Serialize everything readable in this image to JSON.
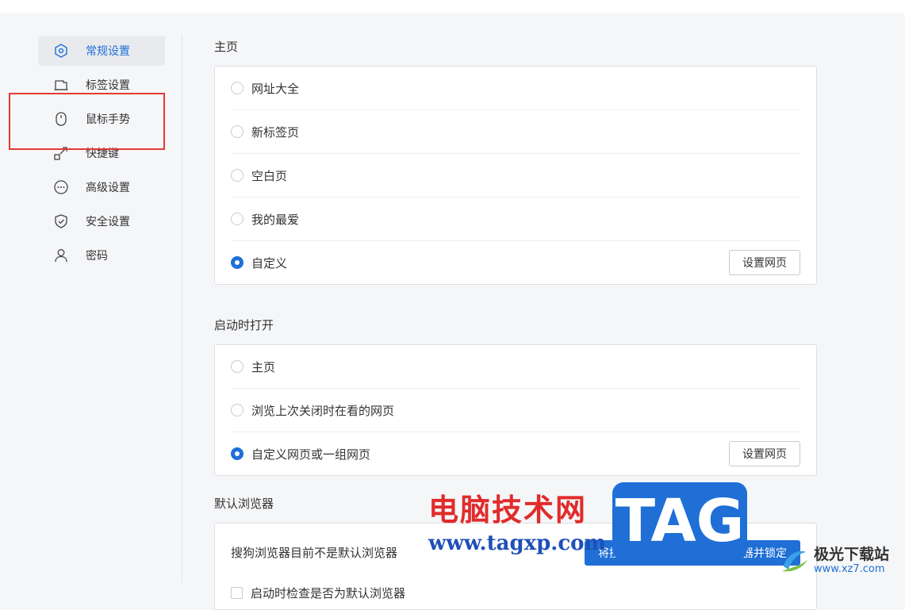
{
  "sidebar": {
    "items": [
      {
        "label": "常规设置",
        "icon": "hexagon-settings-icon",
        "active": true
      },
      {
        "label": "标签设置",
        "icon": "tab-icon"
      },
      {
        "label": "鼠标手势",
        "icon": "mouse-icon"
      },
      {
        "label": "快捷键",
        "icon": "shortcut-icon"
      },
      {
        "label": "高级设置",
        "icon": "more-circle-icon"
      },
      {
        "label": "安全设置",
        "icon": "shield-icon"
      },
      {
        "label": "密码",
        "icon": "user-icon"
      }
    ]
  },
  "homepage": {
    "title": "主页",
    "options": [
      "网址大全",
      "新标签页",
      "空白页",
      "我的最爱",
      "自定义"
    ],
    "selected_index": 4,
    "set_button": "设置网页"
  },
  "startup": {
    "title": "启动时打开",
    "options": [
      "主页",
      "浏览上次关闭时在看的网页",
      "自定义网页或一组网页"
    ],
    "selected_index": 2,
    "set_button": "设置网页"
  },
  "default_browser": {
    "title": "默认浏览器",
    "status": "搜狗浏览器目前不是默认浏览器",
    "set_button": "将搜狗浏览器设置为默认浏览器并锁定",
    "check_label": "启动时检查是否为默认浏览器"
  },
  "watermark": {
    "site_cn": "电脑技术网",
    "site_url": "www.tagxp.com",
    "tag": "TAG",
    "logo_cn": "极光下载站",
    "logo_url": "www.xz7.com"
  },
  "colors": {
    "accent": "#1f6fd6",
    "highlight_border": "#e53935"
  }
}
